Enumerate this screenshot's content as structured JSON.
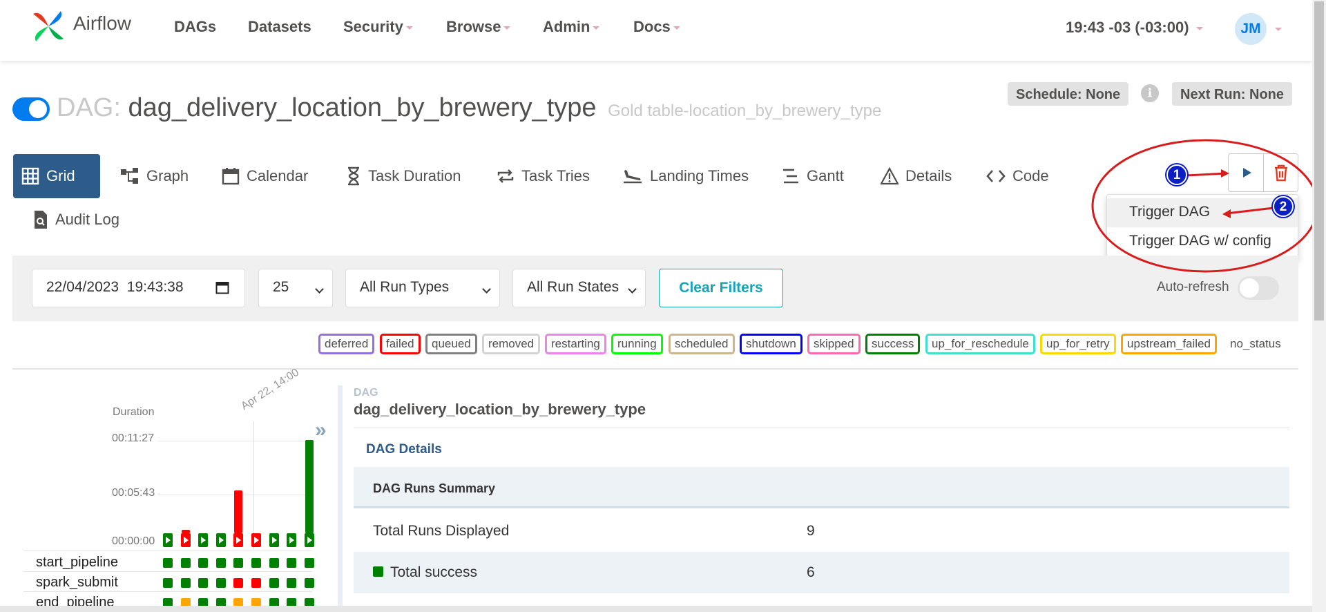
{
  "navbar": {
    "brand": "Airflow",
    "items": [
      {
        "label": "DAGs",
        "dropdown": false
      },
      {
        "label": "Datasets",
        "dropdown": false
      },
      {
        "label": "Security",
        "dropdown": true
      },
      {
        "label": "Browse",
        "dropdown": true
      },
      {
        "label": "Admin",
        "dropdown": true
      },
      {
        "label": "Docs",
        "dropdown": true
      }
    ],
    "time": "19:43 -03 (-03:00)",
    "user_initials": "JM"
  },
  "dag": {
    "label": "DAG:",
    "id": "dag_delivery_location_by_brewery_type",
    "description": "Gold table-location_by_brewery_type",
    "paused": false,
    "schedule": "Schedule: None",
    "next_run": "Next Run: None",
    "info_icon": "i"
  },
  "tabs": [
    {
      "label": "Grid",
      "icon": "grid-icon",
      "active": true
    },
    {
      "label": "Graph",
      "icon": "graph-icon"
    },
    {
      "label": "Calendar",
      "icon": "calendar-icon"
    },
    {
      "label": "Task Duration",
      "icon": "hourglass-icon"
    },
    {
      "label": "Task Tries",
      "icon": "repeat-icon"
    },
    {
      "label": "Landing Times",
      "icon": "plane-landing-icon"
    },
    {
      "label": "Gantt",
      "icon": "gantt-icon"
    },
    {
      "label": "Details",
      "icon": "warning-triangle-icon"
    },
    {
      "label": "Code",
      "icon": "code-icon"
    },
    {
      "label": "Audit Log",
      "icon": "file-search-icon"
    }
  ],
  "actions": {
    "trigger_menu": [
      "Trigger DAG",
      "Trigger DAG w/ config"
    ],
    "markers": [
      "1",
      "2"
    ]
  },
  "filters": {
    "execution_date": "22/04/2023  19:43:38",
    "num_runs": "25",
    "run_type": "All Run Types",
    "run_state": "All Run States",
    "clear_label": "Clear Filters",
    "auto_refresh_label": "Auto-refresh",
    "auto_refresh": false
  },
  "legend": [
    {
      "label": "deferred",
      "color": "#9370db"
    },
    {
      "label": "failed",
      "color": "#ff0000"
    },
    {
      "label": "queued",
      "color": "#808080"
    },
    {
      "label": "removed",
      "color": "#d3d3d3"
    },
    {
      "label": "restarting",
      "color": "#ee82ee"
    },
    {
      "label": "running",
      "color": "#00ff00"
    },
    {
      "label": "scheduled",
      "color": "#d2b48c"
    },
    {
      "label": "shutdown",
      "color": "#0000ff"
    },
    {
      "label": "skipped",
      "color": "#ff69b4"
    },
    {
      "label": "success",
      "color": "#008000"
    },
    {
      "label": "up_for_reschedule",
      "color": "#40e0d0"
    },
    {
      "label": "up_for_retry",
      "color": "#ffd700"
    },
    {
      "label": "upstream_failed",
      "color": "#ffa500"
    },
    {
      "label": "no_status",
      "color": "none"
    }
  ],
  "grid": {
    "duration_label": "Duration",
    "ticks": [
      "00:11:27",
      "00:05:43",
      "00:00:00"
    ],
    "date_label": "Apr 22, 14:00",
    "collapse_icon": "»",
    "runs": [
      {
        "state": "success",
        "duration_ratio": 0.0
      },
      {
        "state": "failed",
        "duration_ratio": 0.04
      },
      {
        "state": "success",
        "duration_ratio": 0.0
      },
      {
        "state": "success",
        "duration_ratio": 0.0
      },
      {
        "state": "failed",
        "duration_ratio": 0.46
      },
      {
        "state": "failed",
        "duration_ratio": 0.0
      },
      {
        "state": "success",
        "duration_ratio": 0.0
      },
      {
        "state": "success",
        "duration_ratio": 0.0
      },
      {
        "state": "success",
        "duration_ratio": 1.0
      }
    ],
    "tasks": [
      {
        "name": "start_pipeline",
        "states": [
          "success",
          "success",
          "success",
          "success",
          "success",
          "success",
          "success",
          "success",
          "success"
        ]
      },
      {
        "name": "spark_submit",
        "states": [
          "success",
          "success",
          "success",
          "success",
          "failed",
          "failed",
          "success",
          "success",
          "success"
        ]
      },
      {
        "name": "end_pipeline",
        "states": [
          "success",
          "upstream_failed",
          "success",
          "success",
          "upstream_failed",
          "upstream_failed",
          "success",
          "success",
          "success"
        ]
      }
    ]
  },
  "details": {
    "small_label": "DAG",
    "title": "dag_delivery_location_by_brewery_type",
    "section_link": "DAG Details",
    "table_header": "DAG Runs Summary",
    "rows": [
      {
        "key": "Total Runs Displayed",
        "value": "9"
      },
      {
        "key": "Total success",
        "value": "6",
        "swatch": "#008000"
      }
    ]
  }
}
